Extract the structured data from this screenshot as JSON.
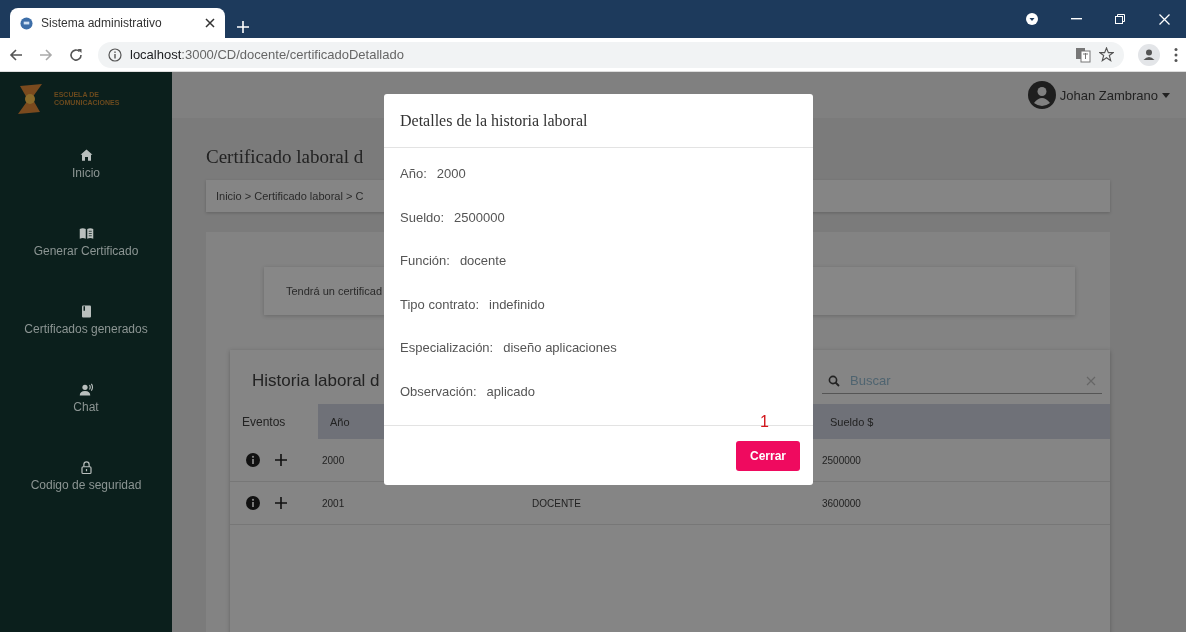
{
  "browser": {
    "tab_title": "Sistema administrativo",
    "url_host": "localhost",
    "url_path": ":3000/CD/docente/certificadoDetallado"
  },
  "header": {
    "logo_lines": [
      "ESCUELA DE",
      "COMUNICACIONES"
    ],
    "user": "Johan Zambrano"
  },
  "sidebar": {
    "items": [
      {
        "label": "Inicio",
        "kind": "home"
      },
      {
        "label": "Generar Certificado",
        "kind": "book"
      },
      {
        "label": "Certificados generados",
        "kind": "notebook"
      },
      {
        "label": "Chat",
        "kind": "chat"
      },
      {
        "label": "Codigo de seguridad",
        "kind": "lock"
      }
    ]
  },
  "page": {
    "title": "Certificado laboral d",
    "breadcrumb": "Inicio > Certificado laboral > C",
    "notice": "Tendrá un certificad",
    "table": {
      "title": "Historia laboral d",
      "search_placeholder": "Buscar",
      "columns": [
        "Eventos",
        "Año",
        "Sueldo $"
      ],
      "rows": [
        {
          "year": "2000",
          "salary": "2500000"
        },
        {
          "year": "2001",
          "function": "DOCENTE",
          "salary": "3600000"
        }
      ]
    }
  },
  "modal": {
    "title": "Detalles de la historia laboral",
    "fields": [
      {
        "label": "Año:",
        "value": "2000"
      },
      {
        "label": "Sueldo:",
        "value": "2500000"
      },
      {
        "label": "Función:",
        "value": "docente"
      },
      {
        "label": "Tipo contrato:",
        "value": "indefinido"
      },
      {
        "label": "Especialización:",
        "value": "diseño aplicaciones"
      },
      {
        "label": "Observación:",
        "value": "aplicado"
      }
    ],
    "annotation": "1",
    "button": "Cerrar"
  }
}
